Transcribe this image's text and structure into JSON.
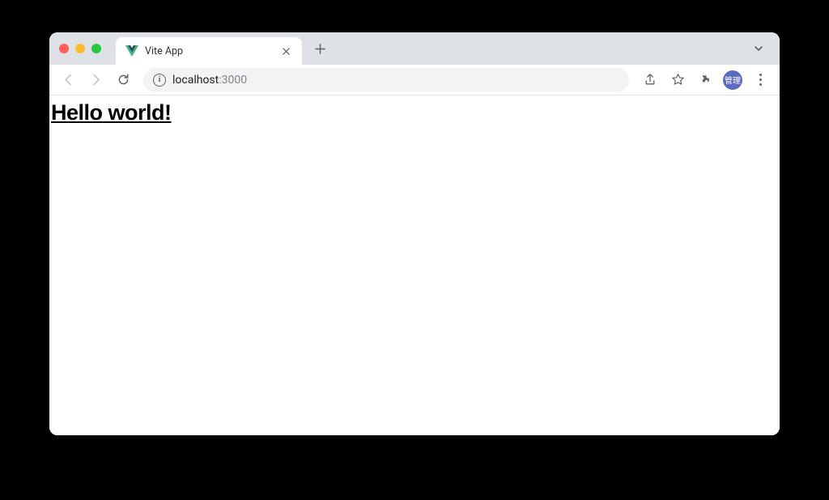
{
  "browser": {
    "tab": {
      "title": "Vite App",
      "favicon": "vue-logo"
    },
    "address": {
      "host": "localhost",
      "port": ":3000"
    },
    "profile_label": "管理"
  },
  "page": {
    "heading": "Hello world!"
  }
}
